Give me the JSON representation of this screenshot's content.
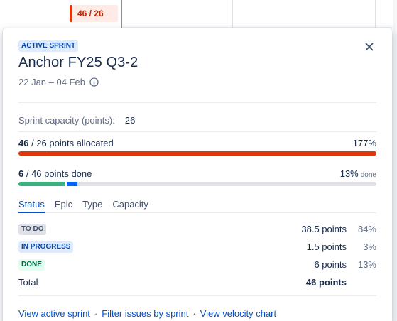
{
  "background": {
    "allocation_chip": "46 / 26"
  },
  "popover": {
    "status": "ACTIVE SPRINT",
    "title": "Anchor FY25 Q3-2",
    "dates": "22 Jan – 04 Feb",
    "capacity": {
      "label": "Sprint capacity (points):",
      "value": "26"
    },
    "allocated": {
      "allocated_value": "46",
      "suffix": " / 26 points allocated",
      "percent": "177%",
      "fraction": 1.0
    },
    "done": {
      "done_value": "6",
      "suffix": " / 46 points done",
      "percent": "13%",
      "percent_suffix": "done",
      "done_fraction": 0.13,
      "in_progress_fraction": 0.03
    },
    "tabs": [
      {
        "label": "Status",
        "active": true
      },
      {
        "label": "Epic",
        "active": false
      },
      {
        "label": "Type",
        "active": false
      },
      {
        "label": "Capacity",
        "active": false
      }
    ],
    "rows": [
      {
        "status": "TO DO",
        "points": "38.5 points",
        "percent": "84%"
      },
      {
        "status": "IN PROGRESS",
        "points": "1.5 points",
        "percent": "3%"
      },
      {
        "status": "DONE",
        "points": "6 points",
        "percent": "13%"
      }
    ],
    "total": {
      "label": "Total",
      "points": "46 points"
    },
    "links": [
      "View active sprint",
      "Filter issues by sprint",
      "View velocity chart"
    ],
    "separator": "·"
  },
  "colors": {
    "accent": "#0052cc",
    "over_capacity": "#de350b",
    "done": "#36b37e",
    "in_progress": "#0065ff"
  }
}
